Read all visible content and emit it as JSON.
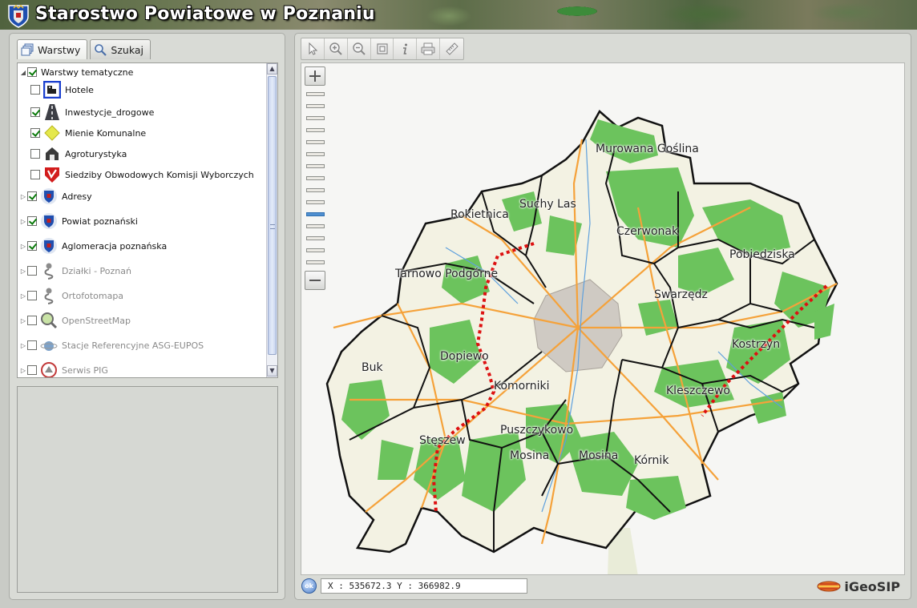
{
  "header": {
    "title": "Starostwo Powiatowe w Poznaniu"
  },
  "tabs": [
    {
      "label": "Warstwy",
      "icon": "layers-icon",
      "active": true
    },
    {
      "label": "Szukaj",
      "icon": "search-icon",
      "active": false
    }
  ],
  "layers": [
    {
      "label": "Warstwy tematyczne",
      "checked": true,
      "disabled": false,
      "icon": "",
      "expander": "expanded",
      "level": 0
    },
    {
      "label": "Hotele",
      "checked": false,
      "disabled": false,
      "icon": "hotel-icon",
      "expander": "",
      "level": 1
    },
    {
      "label": "Inwestycje_drogowe",
      "checked": true,
      "disabled": false,
      "icon": "road-icon",
      "expander": "",
      "level": 1
    },
    {
      "label": "Mienie Komunalne",
      "checked": true,
      "disabled": false,
      "icon": "property-icon",
      "expander": "",
      "level": 1
    },
    {
      "label": "Agroturystyka",
      "checked": false,
      "disabled": false,
      "icon": "agrotourism-icon",
      "expander": "",
      "level": 1
    },
    {
      "label": "Siedziby Obwodowych Komisji Wyborczych",
      "checked": false,
      "disabled": false,
      "icon": "election-icon",
      "expander": "",
      "level": 1
    },
    {
      "label": "Adresy",
      "checked": true,
      "disabled": false,
      "icon": "crest-icon",
      "expander": "collapsed",
      "level": 0
    },
    {
      "label": "Powiat poznański",
      "checked": true,
      "disabled": false,
      "icon": "crest-icon",
      "expander": "collapsed",
      "level": 0
    },
    {
      "label": "Aglomeracja poznańska",
      "checked": true,
      "disabled": false,
      "icon": "crest-icon",
      "expander": "collapsed",
      "level": 0
    },
    {
      "label": "Działki - Poznań",
      "checked": false,
      "disabled": true,
      "icon": "wms-icon",
      "expander": "collapsed",
      "level": 0
    },
    {
      "label": "Ortofotomapa",
      "checked": false,
      "disabled": true,
      "icon": "wms-icon",
      "expander": "collapsed",
      "level": 0
    },
    {
      "label": "OpenStreetMap",
      "checked": false,
      "disabled": true,
      "icon": "magnifier-map-icon",
      "expander": "collapsed",
      "level": 0
    },
    {
      "label": "Stacje Referencyjne ASG-EUPOS",
      "checked": false,
      "disabled": true,
      "icon": "globe-icon",
      "expander": "collapsed",
      "level": 0
    },
    {
      "label": "Serwis PIG",
      "checked": false,
      "disabled": true,
      "icon": "pig-logo-icon",
      "expander": "collapsed",
      "level": 0
    }
  ],
  "toolbar": {
    "tools": [
      "pointer-icon",
      "zoom-in-icon",
      "zoom-out-icon",
      "zoom-extent-icon",
      "info-icon",
      "print-icon",
      "measure-icon"
    ]
  },
  "zoom": {
    "levels": 15,
    "current_level": 10
  },
  "map": {
    "labels": [
      "Murowana Goślina",
      "Suchy Las",
      "Rokietnica",
      "Czerwonak",
      "Pobiedziska",
      "Tarnowo Podgórne",
      "Swarzędz",
      "Kostrzyn",
      "Buk",
      "Dopiewo",
      "Komorniki",
      "Kleszczewo",
      "Stęszew",
      "Puszczykowo",
      "Mosina",
      "Mosina",
      "Kórnik"
    ],
    "colors": {
      "forest": "#6cc35d",
      "land": "#f3f2e3",
      "road": "#f5a23a",
      "boundary": "#111111",
      "planned_road": "#dd1111",
      "city": "#cfcac3"
    }
  },
  "status": {
    "ok_label": "ok",
    "coordinates": "X : 535672.3 Y : 366982.9"
  },
  "brand": {
    "name": "iGeoSIP"
  }
}
